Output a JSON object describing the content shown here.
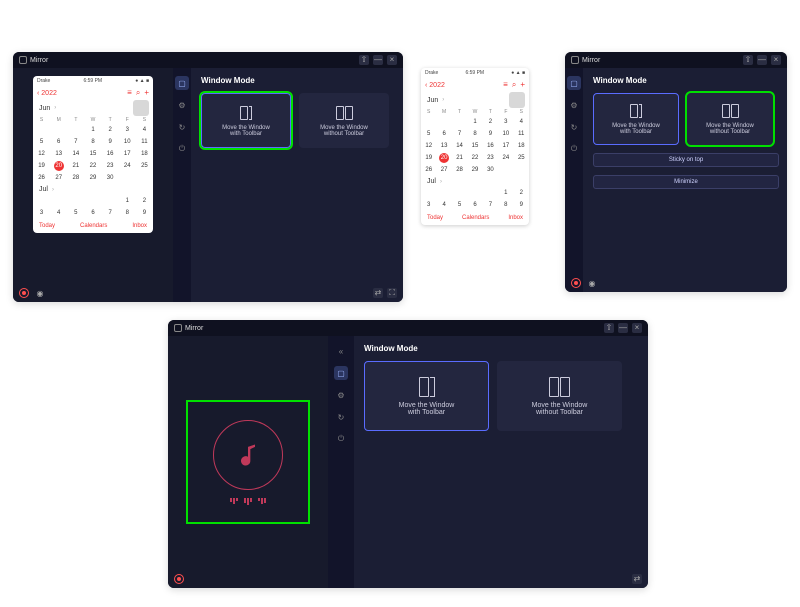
{
  "app": {
    "title": "Mirror"
  },
  "winbtns": {
    "pin": "⇧",
    "min": "—",
    "close": "×"
  },
  "panel": {
    "section_title": "Window Mode",
    "card_with": {
      "l1": "Move the Window",
      "l2": "with Toolbar"
    },
    "card_without": {
      "l1": "Move the Window",
      "l2": "without Toolbar"
    },
    "sticky": "Sticky on top",
    "minimize": "Minimize"
  },
  "phone": {
    "status_left": "Drake",
    "status_mid": "6:59 PM",
    "back": "2022",
    "month1": "Jun",
    "month2": "Jul",
    "dow": [
      "S",
      "M",
      "T",
      "W",
      "T",
      "F",
      "S"
    ],
    "jun_rows": [
      [
        "",
        "",
        "",
        "1",
        "2",
        "3",
        "4"
      ],
      [
        "5",
        "6",
        "7",
        "8",
        "9",
        "10",
        "11"
      ],
      [
        "12",
        "13",
        "14",
        "15",
        "16",
        "17",
        "18"
      ],
      [
        "19",
        "20",
        "21",
        "22",
        "23",
        "24",
        "25"
      ],
      [
        "26",
        "27",
        "28",
        "29",
        "30",
        "",
        ""
      ]
    ],
    "today_cell": "20",
    "jul_rows": [
      [
        "",
        "",
        "",
        "",
        "",
        "1",
        "2"
      ],
      [
        "3",
        "4",
        "5",
        "6",
        "7",
        "8",
        "9"
      ]
    ],
    "foot": {
      "today": "Today",
      "cal": "Calendars",
      "inbox": "Inbox"
    }
  },
  "collapse_icon": "«"
}
